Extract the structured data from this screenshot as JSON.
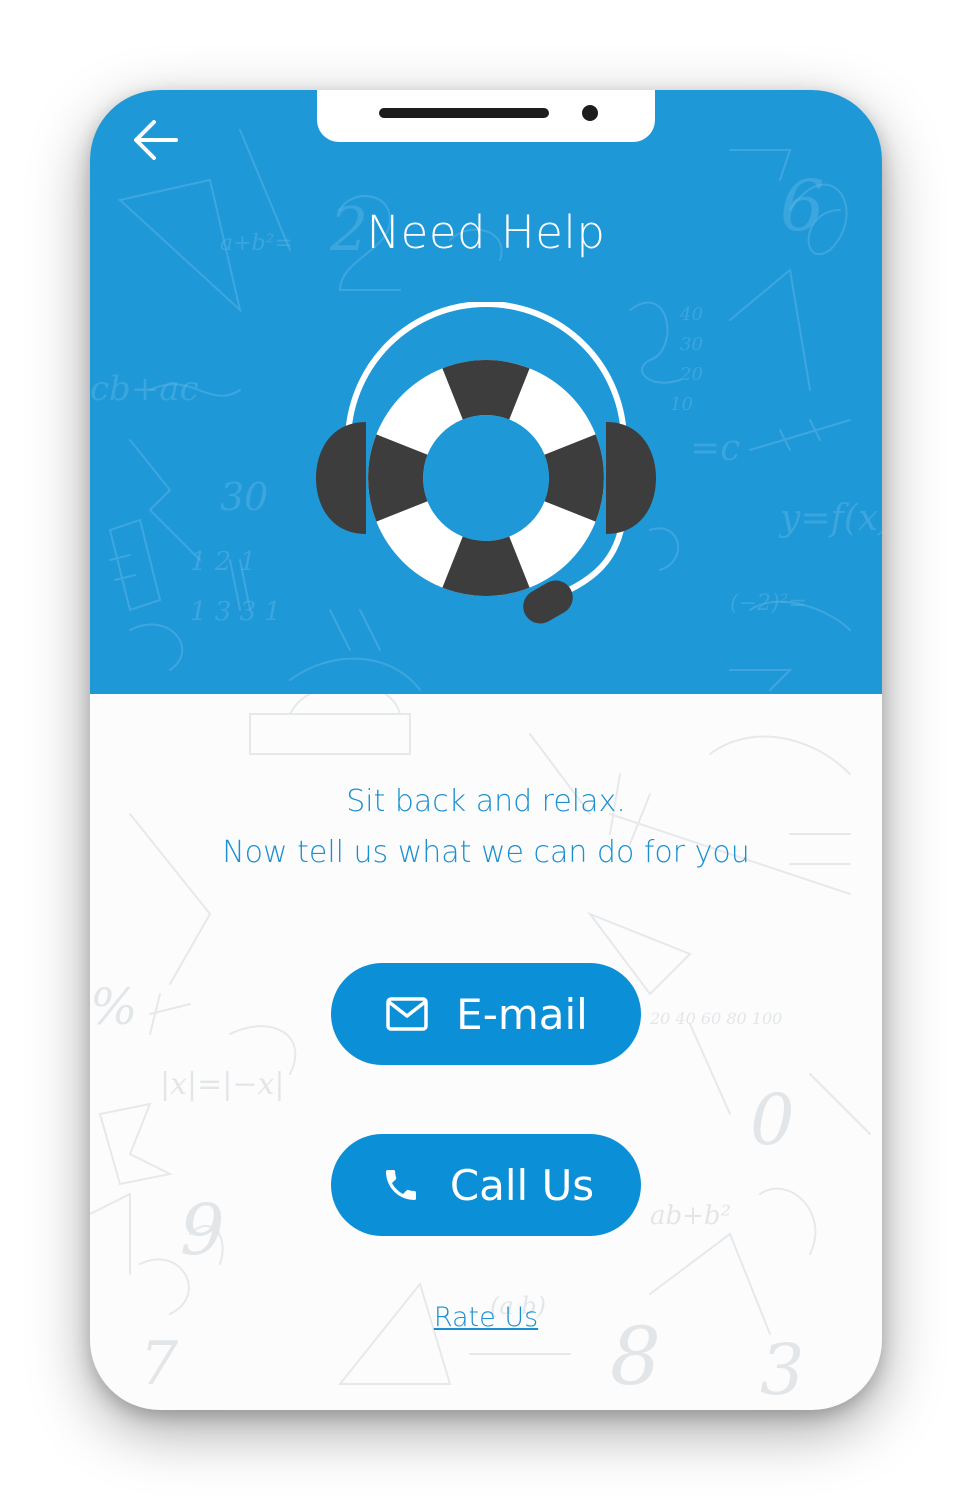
{
  "header": {
    "title": "Need Help",
    "back_icon": "arrow-left-icon",
    "background_color": "#1f98d8",
    "illustration": "lifebuoy-headset-icon"
  },
  "main": {
    "tagline_line1": "Sit back and relax.",
    "tagline_line2": "Now tell us what we can do for you",
    "email_button": {
      "label": "E-mail",
      "icon": "mail-icon"
    },
    "call_button": {
      "label": "Call Us",
      "icon": "phone-icon"
    },
    "rate_link": "Rate Us",
    "accent_color": "#0b8fd6"
  }
}
